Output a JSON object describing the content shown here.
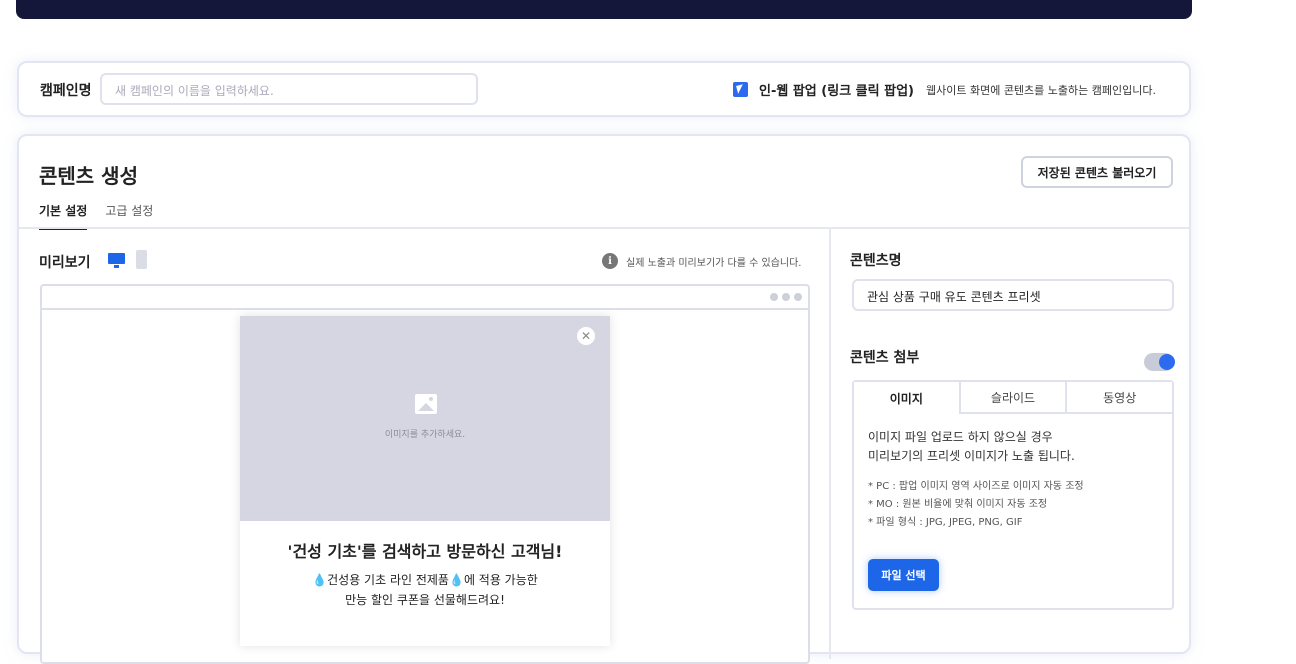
{
  "campaign": {
    "label": "캠페인명",
    "input_placeholder": "새 캠페인의 이름을 입력하세요.",
    "type_title": "인-웹 팝업 (링크 클릭 팝업)",
    "type_desc": "웹사이트 화면에 콘텐츠를 노출하는 캠페인입니다."
  },
  "content": {
    "title": "콘텐츠 생성",
    "load_button": "저장된 콘텐츠 불러오기",
    "tabs": [
      {
        "label": "기본 설정",
        "active": true
      },
      {
        "label": "고급 설정",
        "active": false
      }
    ]
  },
  "preview": {
    "label": "미리보기",
    "info_note": "실제 노출과 미리보기가 다를 수 있습니다.",
    "info_icon": "i",
    "popup": {
      "image_caption": "이미지를 추가하세요.",
      "close_glyph": "✕",
      "title": "'건성 기초'를 검색하고 방문하신 고객님!",
      "body_line1_a": "건성용 기초 라인 전제품",
      "body_line1_b": "에 적용 가능한",
      "drop_glyph": "💧",
      "body_line2": "만능 할인 쿠폰을 선물해드려요!"
    }
  },
  "side": {
    "name_label": "콘텐츠명",
    "name_value": "관심 상품 구매 유도 콘텐츠 프리셋",
    "attach_label": "콘텐츠 첨부",
    "attach_tabs": [
      "이미지",
      "슬라이드",
      "동영상"
    ],
    "attach_msg_1": "이미지 파일 업로드 하지 않으실 경우",
    "attach_msg_2": "미리보기의 프리셋 이미지가 노출 됩니다.",
    "notes": [
      "* PC : 팝업 이미지 영역 사이즈로 이미지 자동 조정",
      "* MO : 원본 비율에 맞춰 이미지 자동 조정",
      "* 파일 형식 : JPG, JPEG, PNG, GIF"
    ],
    "file_button": "파일 선택"
  },
  "colors": {
    "accent": "#1e66e8",
    "topbar": "#15173a"
  }
}
